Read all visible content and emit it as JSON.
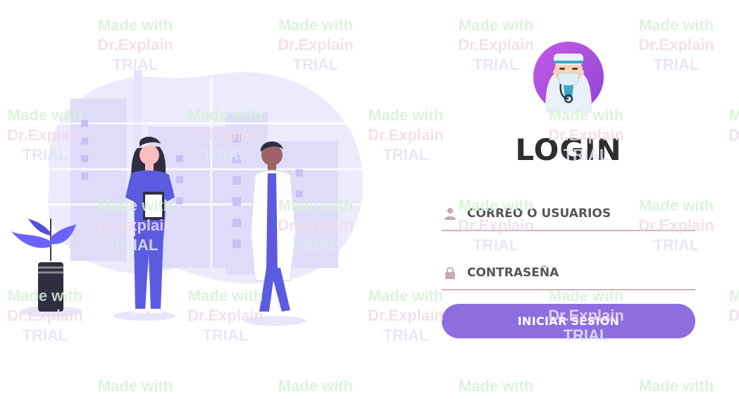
{
  "login": {
    "title": "LOGIN",
    "email_placeholder": "CORREO O USUARIOS",
    "password_placeholder": "CONTRASEÑA",
    "submit_label": "INICIAR SESION"
  },
  "watermark": {
    "line1": "Made with",
    "line2": "Dr.Explain",
    "line3": "TRIAL"
  },
  "colors": {
    "accent": "#8e6edf",
    "title": "#2e2e30",
    "field_underline": "#c9b3bd",
    "icon": "#c9aab2",
    "illustration_blob": "#ecebfc",
    "scrubs": "#5b5be0"
  }
}
